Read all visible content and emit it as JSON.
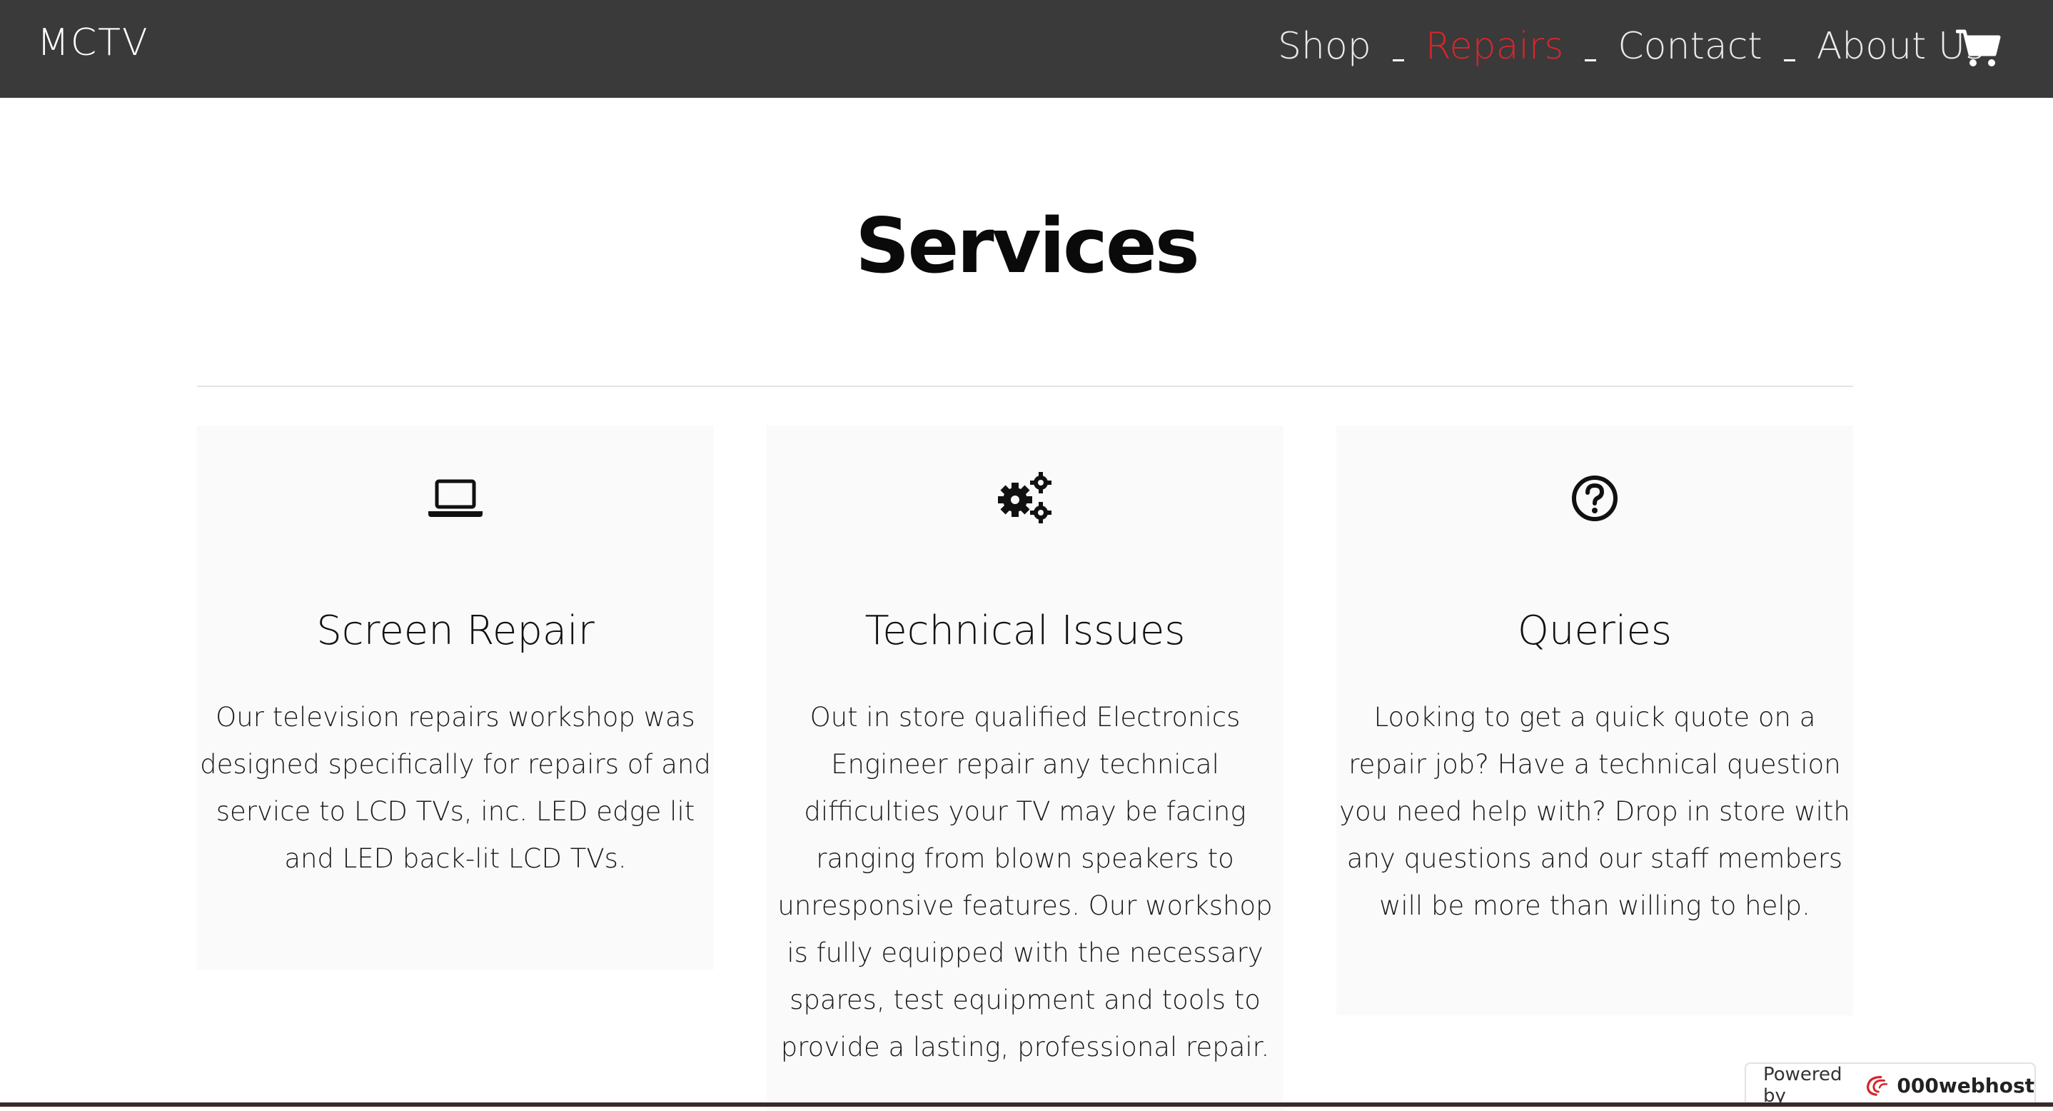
{
  "header": {
    "brand": "MCTV",
    "nav": [
      {
        "label": "Shop"
      },
      {
        "label": "Repairs",
        "active": true
      },
      {
        "label": "Contact"
      },
      {
        "label": "About Us"
      }
    ],
    "cart_icon": "shopping-cart-icon"
  },
  "main": {
    "title": "Services",
    "services": [
      {
        "icon": "laptop-icon",
        "title": "Screen Repair",
        "text": "Our television repairs workshop was designed specifically for repairs of and service  to LCD TVs, inc. LED edge lit and LED back-lit LCD TVs."
      },
      {
        "icon": "gears-icon",
        "title": "Technical Issues",
        "text": "Out in store qualified Electronics Engineer repair any technical difficulties your TV may be facing ranging from blown speakers to unresponsive features. Our workshop is fully equipped with the necessary spares, test equipment and tools to provide a lasting, professional repair."
      },
      {
        "icon": "question-circle-icon",
        "title": "Queries",
        "text": "Looking to get a quick quote on a repair job? Have a technical question you need help with? Drop in store with any questions and our staff members will be more than willing to help."
      }
    ]
  },
  "badge": {
    "prefix": "Powered by",
    "brand": "000webhost"
  },
  "colors": {
    "navbar": "#3a3a3a",
    "active": "#d6262c",
    "card": "#fafafa"
  }
}
